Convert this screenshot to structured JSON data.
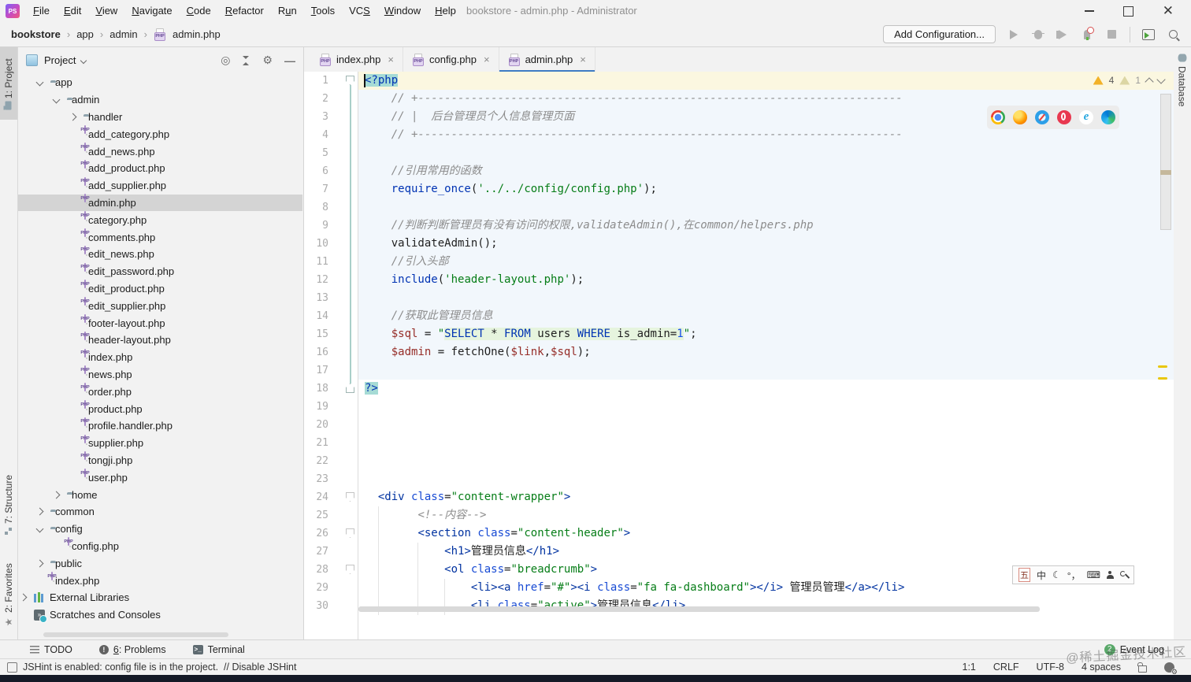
{
  "colors": {
    "accent_tab_underline": "#3E7CC4",
    "selection_teal": "#A6DBD5",
    "caret_row_yellow": "#FBF7E0",
    "php_region_tint": "#F2F7FC",
    "sql_injection_bg": "#E6F4DE",
    "warning_yellow": "#F2B228",
    "event_log_badge_green": "#59A869",
    "selected_row_gray": "#D4D4D4"
  },
  "title_bar": {
    "logo_text": "PS",
    "menus": [
      {
        "label": "File",
        "u": 0
      },
      {
        "label": "Edit",
        "u": 0
      },
      {
        "label": "View",
        "u": 0
      },
      {
        "label": "Navigate",
        "u": 0
      },
      {
        "label": "Code",
        "u": 0
      },
      {
        "label": "Refactor",
        "u": 0
      },
      {
        "label": "Run",
        "u": 1
      },
      {
        "label": "Tools",
        "u": 0
      },
      {
        "label": "VCS",
        "u": 2
      },
      {
        "label": "Window",
        "u": 0
      },
      {
        "label": "Help",
        "u": 0
      }
    ],
    "title": "bookstore - admin.php - Administrator"
  },
  "toolbar": {
    "breadcrumbs": [
      "bookstore",
      "app",
      "admin",
      "admin.php"
    ],
    "add_configuration_label": "Add Configuration...",
    "icons": [
      "run",
      "debug",
      "coverage",
      "profiler",
      "stop",
      "sep",
      "runany",
      "search"
    ]
  },
  "left_stripe": {
    "project_label": "1: Project",
    "structure_label": "7: Structure",
    "favorites_label": "2: Favorites"
  },
  "right_stripe": {
    "database_label": "Database"
  },
  "project_panel": {
    "header_label": "Project",
    "tree": [
      {
        "label": "app",
        "level": 1,
        "icon": "folder",
        "arrow": "open"
      },
      {
        "label": "admin",
        "level": 2,
        "icon": "folder",
        "arrow": "open"
      },
      {
        "label": "handler",
        "level": 3,
        "icon": "folder",
        "arrow": "closed"
      },
      {
        "label": "add_category.php",
        "level": 3,
        "icon": "php"
      },
      {
        "label": "add_news.php",
        "level": 3,
        "icon": "php"
      },
      {
        "label": "add_product.php",
        "level": 3,
        "icon": "php"
      },
      {
        "label": "add_supplier.php",
        "level": 3,
        "icon": "php"
      },
      {
        "label": "admin.php",
        "level": 3,
        "icon": "php",
        "selected": true
      },
      {
        "label": "category.php",
        "level": 3,
        "icon": "php"
      },
      {
        "label": "comments.php",
        "level": 3,
        "icon": "php"
      },
      {
        "label": "edit_news.php",
        "level": 3,
        "icon": "php"
      },
      {
        "label": "edit_password.php",
        "level": 3,
        "icon": "php"
      },
      {
        "label": "edit_product.php",
        "level": 3,
        "icon": "php"
      },
      {
        "label": "edit_supplier.php",
        "level": 3,
        "icon": "php"
      },
      {
        "label": "footer-layout.php",
        "level": 3,
        "icon": "php"
      },
      {
        "label": "header-layout.php",
        "level": 3,
        "icon": "php"
      },
      {
        "label": "index.php",
        "level": 3,
        "icon": "php"
      },
      {
        "label": "news.php",
        "level": 3,
        "icon": "php"
      },
      {
        "label": "order.php",
        "level": 3,
        "icon": "php"
      },
      {
        "label": "product.php",
        "level": 3,
        "icon": "php"
      },
      {
        "label": "profile.handler.php",
        "level": 3,
        "icon": "php"
      },
      {
        "label": "supplier.php",
        "level": 3,
        "icon": "php"
      },
      {
        "label": "tongji.php",
        "level": 3,
        "icon": "php"
      },
      {
        "label": "user.php",
        "level": 3,
        "icon": "php"
      },
      {
        "label": "home",
        "level": 2,
        "icon": "folder",
        "arrow": "closed"
      },
      {
        "label": "common",
        "level": 1,
        "icon": "folder",
        "arrow": "closed"
      },
      {
        "label": "config",
        "level": 1,
        "icon": "folder",
        "arrow": "open"
      },
      {
        "label": "config.php",
        "level": 2,
        "icon": "php"
      },
      {
        "label": "public",
        "level": 1,
        "icon": "folder",
        "arrow": "closed"
      },
      {
        "label": "index.php",
        "level": 1,
        "icon": "php"
      },
      {
        "label": "External Libraries",
        "level": 0,
        "icon": "lib",
        "arrow": "closed"
      },
      {
        "label": "Scratches and Consoles",
        "level": 0,
        "icon": "scratch"
      }
    ]
  },
  "editor": {
    "tabs": [
      {
        "label": "index.php",
        "active": false
      },
      {
        "label": "config.php",
        "active": false
      },
      {
        "label": "admin.php",
        "active": true
      }
    ],
    "warnings": {
      "strong": "4",
      "weak": "1"
    },
    "browsers": [
      "chrome",
      "firefox",
      "safari",
      "opera",
      "ie",
      "edge"
    ],
    "ime": [
      {
        "kind": "wubi",
        "value": "五",
        "name": "ime-wubi-icon"
      },
      {
        "kind": "text",
        "value": "中",
        "name": "ime-chinese-mode-icon"
      },
      {
        "kind": "text",
        "value": "☾",
        "name": "ime-moon-icon"
      },
      {
        "kind": "text",
        "value": "°，",
        "name": "ime-punctuation-icon"
      },
      {
        "kind": "text",
        "value": "⌨",
        "name": "ime-keyboard-icon"
      },
      {
        "kind": "user",
        "value": "",
        "name": "ime-user-icon"
      },
      {
        "kind": "wrench",
        "value": "",
        "name": "ime-wrench-icon"
      }
    ],
    "lines": [
      {
        "n": 1,
        "bg": "caret",
        "fold": "start",
        "seg": [
          [
            "phptag",
            "<?php"
          ]
        ]
      },
      {
        "n": 2,
        "bg": "php",
        "seg": [
          [
            "cmt",
            "    // +-------------------------------------------------------------------------"
          ]
        ]
      },
      {
        "n": 3,
        "bg": "php",
        "seg": [
          [
            "cmt",
            "    // |  后台管理员个人信息管理页面"
          ]
        ]
      },
      {
        "n": 4,
        "bg": "php",
        "seg": [
          [
            "cmt",
            "    // +-------------------------------------------------------------------------"
          ]
        ]
      },
      {
        "n": 5,
        "bg": "php",
        "seg": []
      },
      {
        "n": 6,
        "bg": "php",
        "seg": [
          [
            "cmt",
            "    //引用常用的函数"
          ]
        ]
      },
      {
        "n": 7,
        "bg": "php",
        "seg": [
          [
            "pl",
            "    "
          ],
          [
            "kw",
            "require_once"
          ],
          [
            "pl",
            "("
          ],
          [
            "str",
            "'../../config/config.php'"
          ],
          [
            "pl",
            ");"
          ]
        ]
      },
      {
        "n": 8,
        "bg": "php",
        "seg": []
      },
      {
        "n": 9,
        "bg": "php",
        "seg": [
          [
            "cmt",
            "    //判断判断管理员有没有访问的权限,validateAdmin(),在common/helpers.php"
          ]
        ]
      },
      {
        "n": 10,
        "bg": "php",
        "seg": [
          [
            "pl",
            "    validateAdmin();"
          ]
        ]
      },
      {
        "n": 11,
        "bg": "php",
        "seg": [
          [
            "cmt",
            "    //引入头部"
          ]
        ]
      },
      {
        "n": 12,
        "bg": "php",
        "seg": [
          [
            "pl",
            "    "
          ],
          [
            "kw",
            "include"
          ],
          [
            "pl",
            "("
          ],
          [
            "str",
            "'header-layout.php'"
          ],
          [
            "pl",
            ");"
          ]
        ]
      },
      {
        "n": 13,
        "bg": "php",
        "seg": []
      },
      {
        "n": 14,
        "bg": "php",
        "seg": [
          [
            "cmt",
            "    //获取此管理员信息"
          ]
        ]
      },
      {
        "n": 15,
        "bg": "php",
        "seg": [
          [
            "pl",
            "    "
          ],
          [
            "var",
            "$sql"
          ],
          [
            "pl",
            " = "
          ],
          [
            "str",
            "\""
          ],
          [
            "sk",
            "SELECT"
          ],
          [
            "st",
            " * "
          ],
          [
            "sk",
            "FROM"
          ],
          [
            "st",
            " users "
          ],
          [
            "sk",
            "WHERE"
          ],
          [
            "st",
            " is_admin="
          ],
          [
            "sn",
            "1"
          ],
          [
            "str",
            "\""
          ],
          [
            "pl",
            ";"
          ]
        ]
      },
      {
        "n": 16,
        "bg": "php",
        "seg": [
          [
            "pl",
            "    "
          ],
          [
            "var",
            "$admin"
          ],
          [
            "pl",
            " = fetchOne("
          ],
          [
            "var",
            "$link"
          ],
          [
            "pl",
            ","
          ],
          [
            "var",
            "$sql"
          ],
          [
            "pl",
            ");"
          ]
        ]
      },
      {
        "n": 17,
        "bg": "php",
        "seg": []
      },
      {
        "n": 18,
        "fold": "end",
        "seg": [
          [
            "phptag",
            "?>"
          ]
        ]
      },
      {
        "n": 19,
        "seg": []
      },
      {
        "n": 20,
        "seg": []
      },
      {
        "n": 21,
        "seg": []
      },
      {
        "n": 22,
        "seg": []
      },
      {
        "n": 23,
        "seg": []
      },
      {
        "n": 24,
        "fold": "collapse",
        "seg": [
          [
            "pl",
            "  "
          ],
          [
            "tag",
            "<div"
          ],
          [
            "pl",
            " "
          ],
          [
            "attr",
            "class"
          ],
          [
            "pl",
            "="
          ],
          [
            "str",
            "\"content-wrapper\""
          ],
          [
            "tag",
            ">"
          ]
        ]
      },
      {
        "n": 25,
        "seg": [
          [
            "pl",
            "        "
          ],
          [
            "cmt",
            "<!--内容-->"
          ]
        ]
      },
      {
        "n": 26,
        "fold": "collapse",
        "seg": [
          [
            "pl",
            "        "
          ],
          [
            "tag",
            "<section"
          ],
          [
            "pl",
            " "
          ],
          [
            "attr",
            "class"
          ],
          [
            "pl",
            "="
          ],
          [
            "str",
            "\"content-header\""
          ],
          [
            "tag",
            ">"
          ]
        ]
      },
      {
        "n": 27,
        "seg": [
          [
            "pl",
            "            "
          ],
          [
            "tag",
            "<h1>"
          ],
          [
            "pl",
            "管理员信息"
          ],
          [
            "tag",
            "</h1>"
          ]
        ]
      },
      {
        "n": 28,
        "fold": "collapse",
        "seg": [
          [
            "pl",
            "            "
          ],
          [
            "tag",
            "<ol"
          ],
          [
            "pl",
            " "
          ],
          [
            "attr",
            "class"
          ],
          [
            "pl",
            "="
          ],
          [
            "str",
            "\"breadcrumb\""
          ],
          [
            "tag",
            ">"
          ]
        ]
      },
      {
        "n": 29,
        "seg": [
          [
            "pl",
            "                "
          ],
          [
            "tag",
            "<li><a"
          ],
          [
            "pl",
            " "
          ],
          [
            "attr",
            "href"
          ],
          [
            "pl",
            "="
          ],
          [
            "str",
            "\"#\""
          ],
          [
            "tag",
            "><i"
          ],
          [
            "pl",
            " "
          ],
          [
            "attr",
            "class"
          ],
          [
            "pl",
            "="
          ],
          [
            "str",
            "\"fa fa-dashboard\""
          ],
          [
            "tag",
            "></i>"
          ],
          [
            "pl",
            " 管理员管理"
          ],
          [
            "tag",
            "</a></li>"
          ]
        ]
      },
      {
        "n": 30,
        "seg": [
          [
            "pl",
            "                "
          ],
          [
            "tag",
            "<li"
          ],
          [
            "pl",
            " "
          ],
          [
            "attr",
            "class"
          ],
          [
            "pl",
            "="
          ],
          [
            "str",
            "\"active\""
          ],
          [
            "tag",
            ">"
          ],
          [
            "pl",
            "管理员信息"
          ],
          [
            "tag",
            "</li>"
          ]
        ]
      }
    ]
  },
  "bottom_bar": {
    "items": [
      {
        "icon": "todo-icon",
        "label": "TODO",
        "u": -1
      },
      {
        "icon": "problems-icon",
        "label": "6: Problems",
        "u": 0
      },
      {
        "icon": "terminal-icon",
        "label": "Terminal",
        "u": -1
      }
    ],
    "event_log_label": "Event Log",
    "event_log_badge": "2"
  },
  "status_bar": {
    "message": "JSHint is enabled: config file is in the project.",
    "action": "// Disable JSHint",
    "caret_position": "1:1",
    "line_separator": "CRLF",
    "encoding": "UTF-8",
    "indent": "4 spaces"
  },
  "watermark": "@稀土掘金技术社区"
}
